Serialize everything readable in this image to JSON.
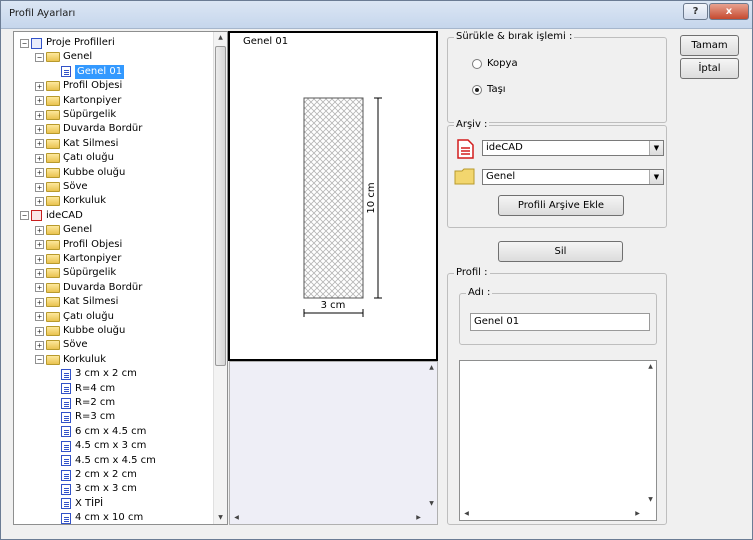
{
  "window": {
    "title": "Profil Ayarları",
    "help_label": "?",
    "close_label": "x"
  },
  "tree": {
    "nodes": [
      {
        "label": "Proje Profilleri",
        "level": 0,
        "kind": "root",
        "exp": "−"
      },
      {
        "label": "Genel",
        "level": 1,
        "kind": "folder",
        "exp": "−"
      },
      {
        "label": "Genel 01",
        "level": 2,
        "kind": "doc",
        "selected": true
      },
      {
        "label": "Profil Objesi",
        "level": 1,
        "kind": "folder",
        "exp": "+"
      },
      {
        "label": "Kartonpiyer",
        "level": 1,
        "kind": "folder",
        "exp": "+"
      },
      {
        "label": "Süpürgelik",
        "level": 1,
        "kind": "folder",
        "exp": "+"
      },
      {
        "label": "Duvarda Bordür",
        "level": 1,
        "kind": "folder",
        "exp": "+"
      },
      {
        "label": "Kat Silmesi",
        "level": 1,
        "kind": "folder",
        "exp": "+"
      },
      {
        "label": "Çatı oluğu",
        "level": 1,
        "kind": "folder",
        "exp": "+"
      },
      {
        "label": "Kubbe oluğu",
        "level": 1,
        "kind": "folder",
        "exp": "+"
      },
      {
        "label": "Söve",
        "level": 1,
        "kind": "folder",
        "exp": "+"
      },
      {
        "label": "Korkuluk",
        "level": 1,
        "kind": "folder",
        "exp": "+"
      },
      {
        "label": "ideCAD",
        "level": 0,
        "kind": "root-red",
        "exp": "−"
      },
      {
        "label": "Genel",
        "level": 1,
        "kind": "folder",
        "exp": "+"
      },
      {
        "label": "Profil Objesi",
        "level": 1,
        "kind": "folder",
        "exp": "+"
      },
      {
        "label": "Kartonpiyer",
        "level": 1,
        "kind": "folder",
        "exp": "+"
      },
      {
        "label": "Süpürgelik",
        "level": 1,
        "kind": "folder",
        "exp": "+"
      },
      {
        "label": "Duvarda Bordür",
        "level": 1,
        "kind": "folder",
        "exp": "+"
      },
      {
        "label": "Kat Silmesi",
        "level": 1,
        "kind": "folder",
        "exp": "+"
      },
      {
        "label": "Çatı oluğu",
        "level": 1,
        "kind": "folder",
        "exp": "+"
      },
      {
        "label": "Kubbe oluğu",
        "level": 1,
        "kind": "folder",
        "exp": "+"
      },
      {
        "label": "Söve",
        "level": 1,
        "kind": "folder",
        "exp": "+"
      },
      {
        "label": "Korkuluk",
        "level": 1,
        "kind": "folder",
        "exp": "−"
      },
      {
        "label": "3 cm x 2 cm",
        "level": 2,
        "kind": "doc"
      },
      {
        "label": "R=4 cm",
        "level": 2,
        "kind": "doc"
      },
      {
        "label": "R=2 cm",
        "level": 2,
        "kind": "doc"
      },
      {
        "label": "R=3 cm",
        "level": 2,
        "kind": "doc"
      },
      {
        "label": "6 cm x 4.5 cm",
        "level": 2,
        "kind": "doc"
      },
      {
        "label": "4.5 cm x 3 cm",
        "level": 2,
        "kind": "doc"
      },
      {
        "label": "4.5 cm x 4.5 cm",
        "level": 2,
        "kind": "doc"
      },
      {
        "label": "2 cm x 2 cm",
        "level": 2,
        "kind": "doc"
      },
      {
        "label": "3 cm x 3 cm",
        "level": 2,
        "kind": "doc"
      },
      {
        "label": "X TİPİ",
        "level": 2,
        "kind": "doc"
      },
      {
        "label": "4 cm x 10 cm",
        "level": 2,
        "kind": "doc"
      }
    ]
  },
  "preview": {
    "title": "Genel 01",
    "height_label": "10 cm",
    "width_label": "3 cm"
  },
  "drag_drop": {
    "title": "Sürükle & bırak işlemi :",
    "copy_label": "Kopya",
    "move_label": "Taşı",
    "selected": "move"
  },
  "archive": {
    "title": "Arşiv :",
    "archive_value": "ideCAD",
    "folder_value": "Genel",
    "add_button": "Profili Arşive Ekle"
  },
  "delete_button": "Sil",
  "profile": {
    "title": "Profil :",
    "name_title": "Adı :",
    "name_value": "Genel 01"
  },
  "ok_button": "Tamam",
  "cancel_button": "İptal"
}
